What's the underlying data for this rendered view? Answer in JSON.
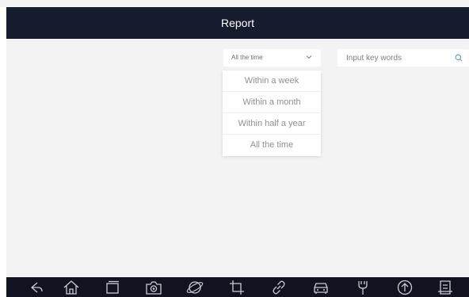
{
  "header": {
    "title": "Report"
  },
  "filter": {
    "selected": "All the time",
    "options": [
      "Within a week",
      "Within a month",
      "Within half a year",
      "All the time"
    ]
  },
  "search": {
    "placeholder": "Input key words",
    "value": ""
  },
  "navbar": {
    "icons": [
      "back-icon",
      "home-icon",
      "recent-apps-icon",
      "camera-icon",
      "browser-icon",
      "crop-icon",
      "link-icon",
      "car-icon",
      "tools-icon",
      "upload-icon",
      "report-icon"
    ]
  },
  "colors": {
    "header_bg": "#161b2e",
    "nav_bg": "#111420",
    "accent": "#4a90e2"
  }
}
